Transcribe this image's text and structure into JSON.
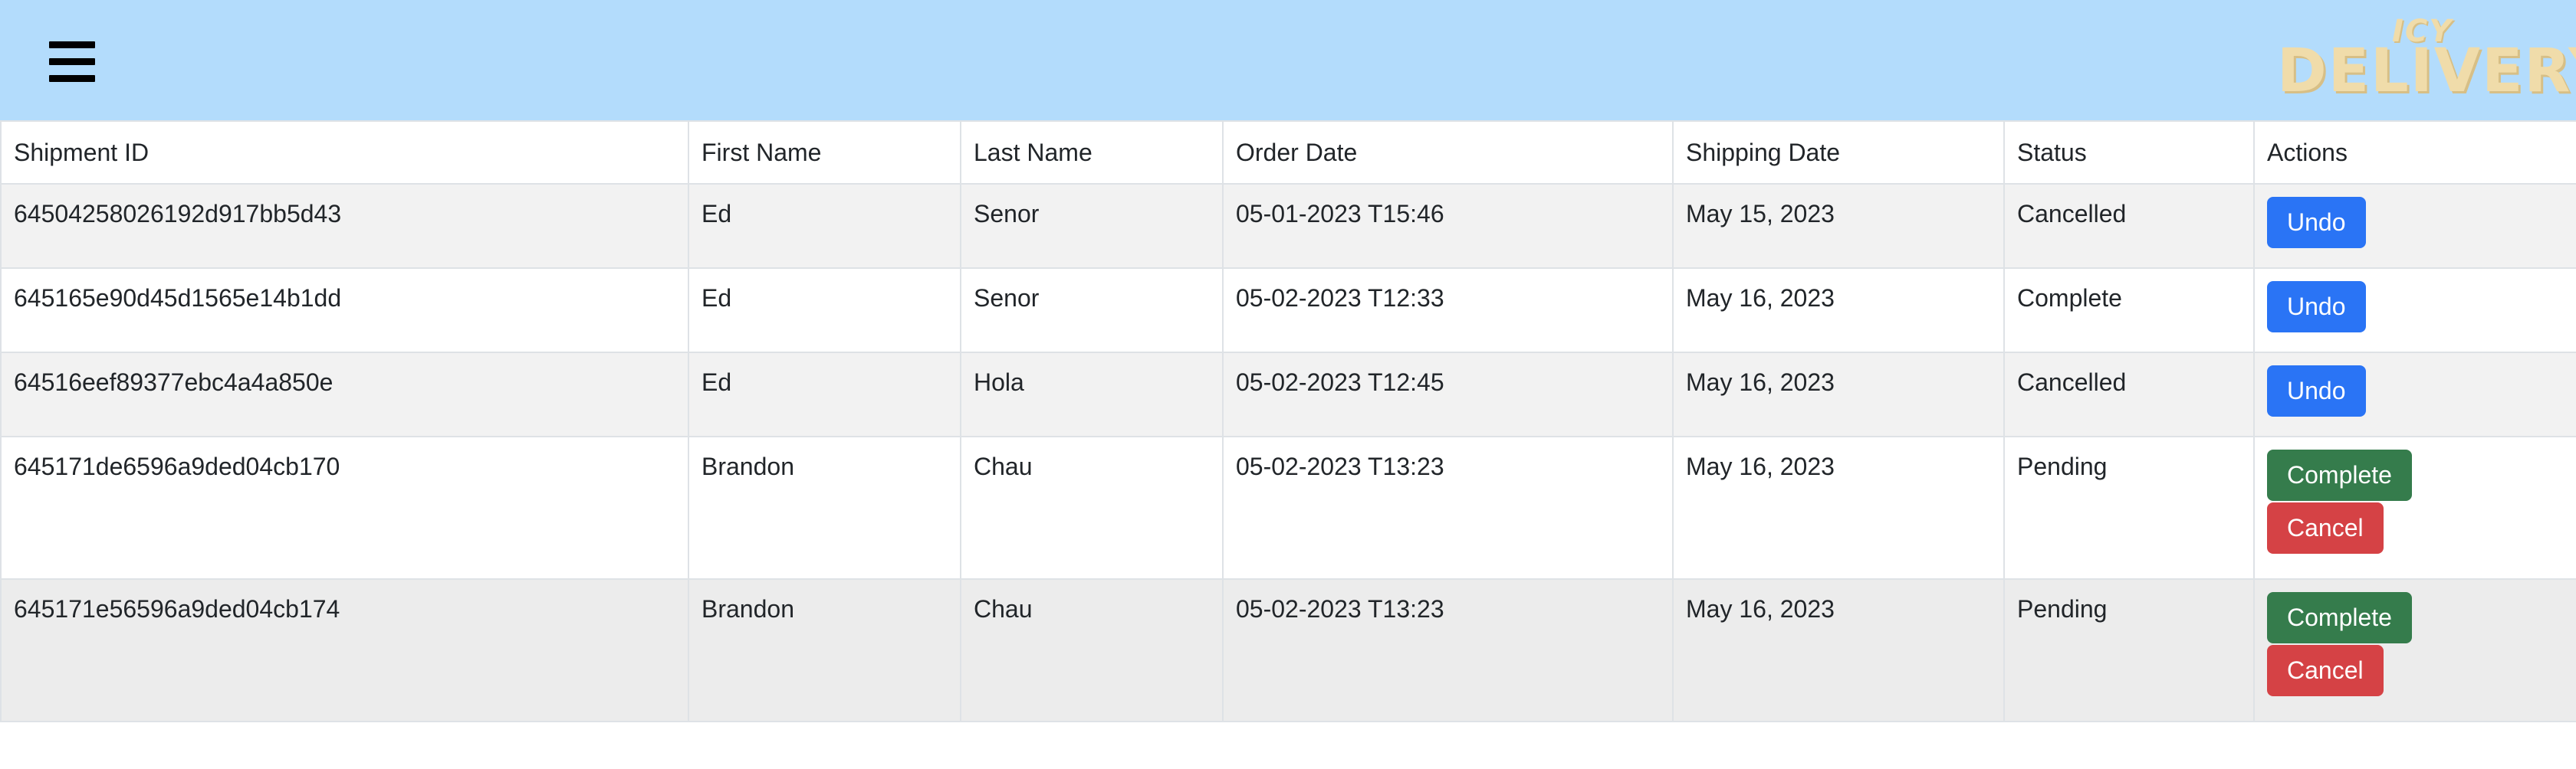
{
  "header": {
    "logo_top": "ICY",
    "logo_main": "DELIVERY",
    "colors": {
      "bar": "#b3dcfc",
      "logo": "#f0dcaa"
    }
  },
  "table": {
    "columns": [
      "Shipment ID",
      "First Name",
      "Last Name",
      "Order Date",
      "Shipping Date",
      "Status",
      "Actions"
    ],
    "rows": [
      {
        "id": "64504258026192d917bb5d43",
        "first": "Ed",
        "last": "Senor",
        "order_date": "05-01-2023 T15:46",
        "ship_date": "May 15, 2023",
        "status": "Cancelled",
        "actions": [
          "Undo"
        ]
      },
      {
        "id": "645165e90d45d1565e14b1dd",
        "first": "Ed",
        "last": "Senor",
        "order_date": "05-02-2023 T12:33",
        "ship_date": "May 16, 2023",
        "status": "Complete",
        "actions": [
          "Undo"
        ]
      },
      {
        "id": "64516eef89377ebc4a4a850e",
        "first": "Ed",
        "last": "Hola",
        "order_date": "05-02-2023 T12:45",
        "ship_date": "May 16, 2023",
        "status": "Cancelled",
        "actions": [
          "Undo"
        ]
      },
      {
        "id": "645171de6596a9ded04cb170",
        "first": "Brandon",
        "last": "Chau",
        "order_date": "05-02-2023 T13:23",
        "ship_date": "May 16, 2023",
        "status": "Pending",
        "actions": [
          "Complete",
          "Cancel"
        ]
      },
      {
        "id": "645171e56596a9ded04cb174",
        "first": "Brandon",
        "last": "Chau",
        "order_date": "05-02-2023 T13:23",
        "ship_date": "May 16, 2023",
        "status": "Pending",
        "actions": [
          "Complete",
          "Cancel"
        ]
      }
    ]
  },
  "button_colors": {
    "Undo": "#2a74f5",
    "Complete": "#357c4c",
    "Cancel": "#d54245"
  }
}
